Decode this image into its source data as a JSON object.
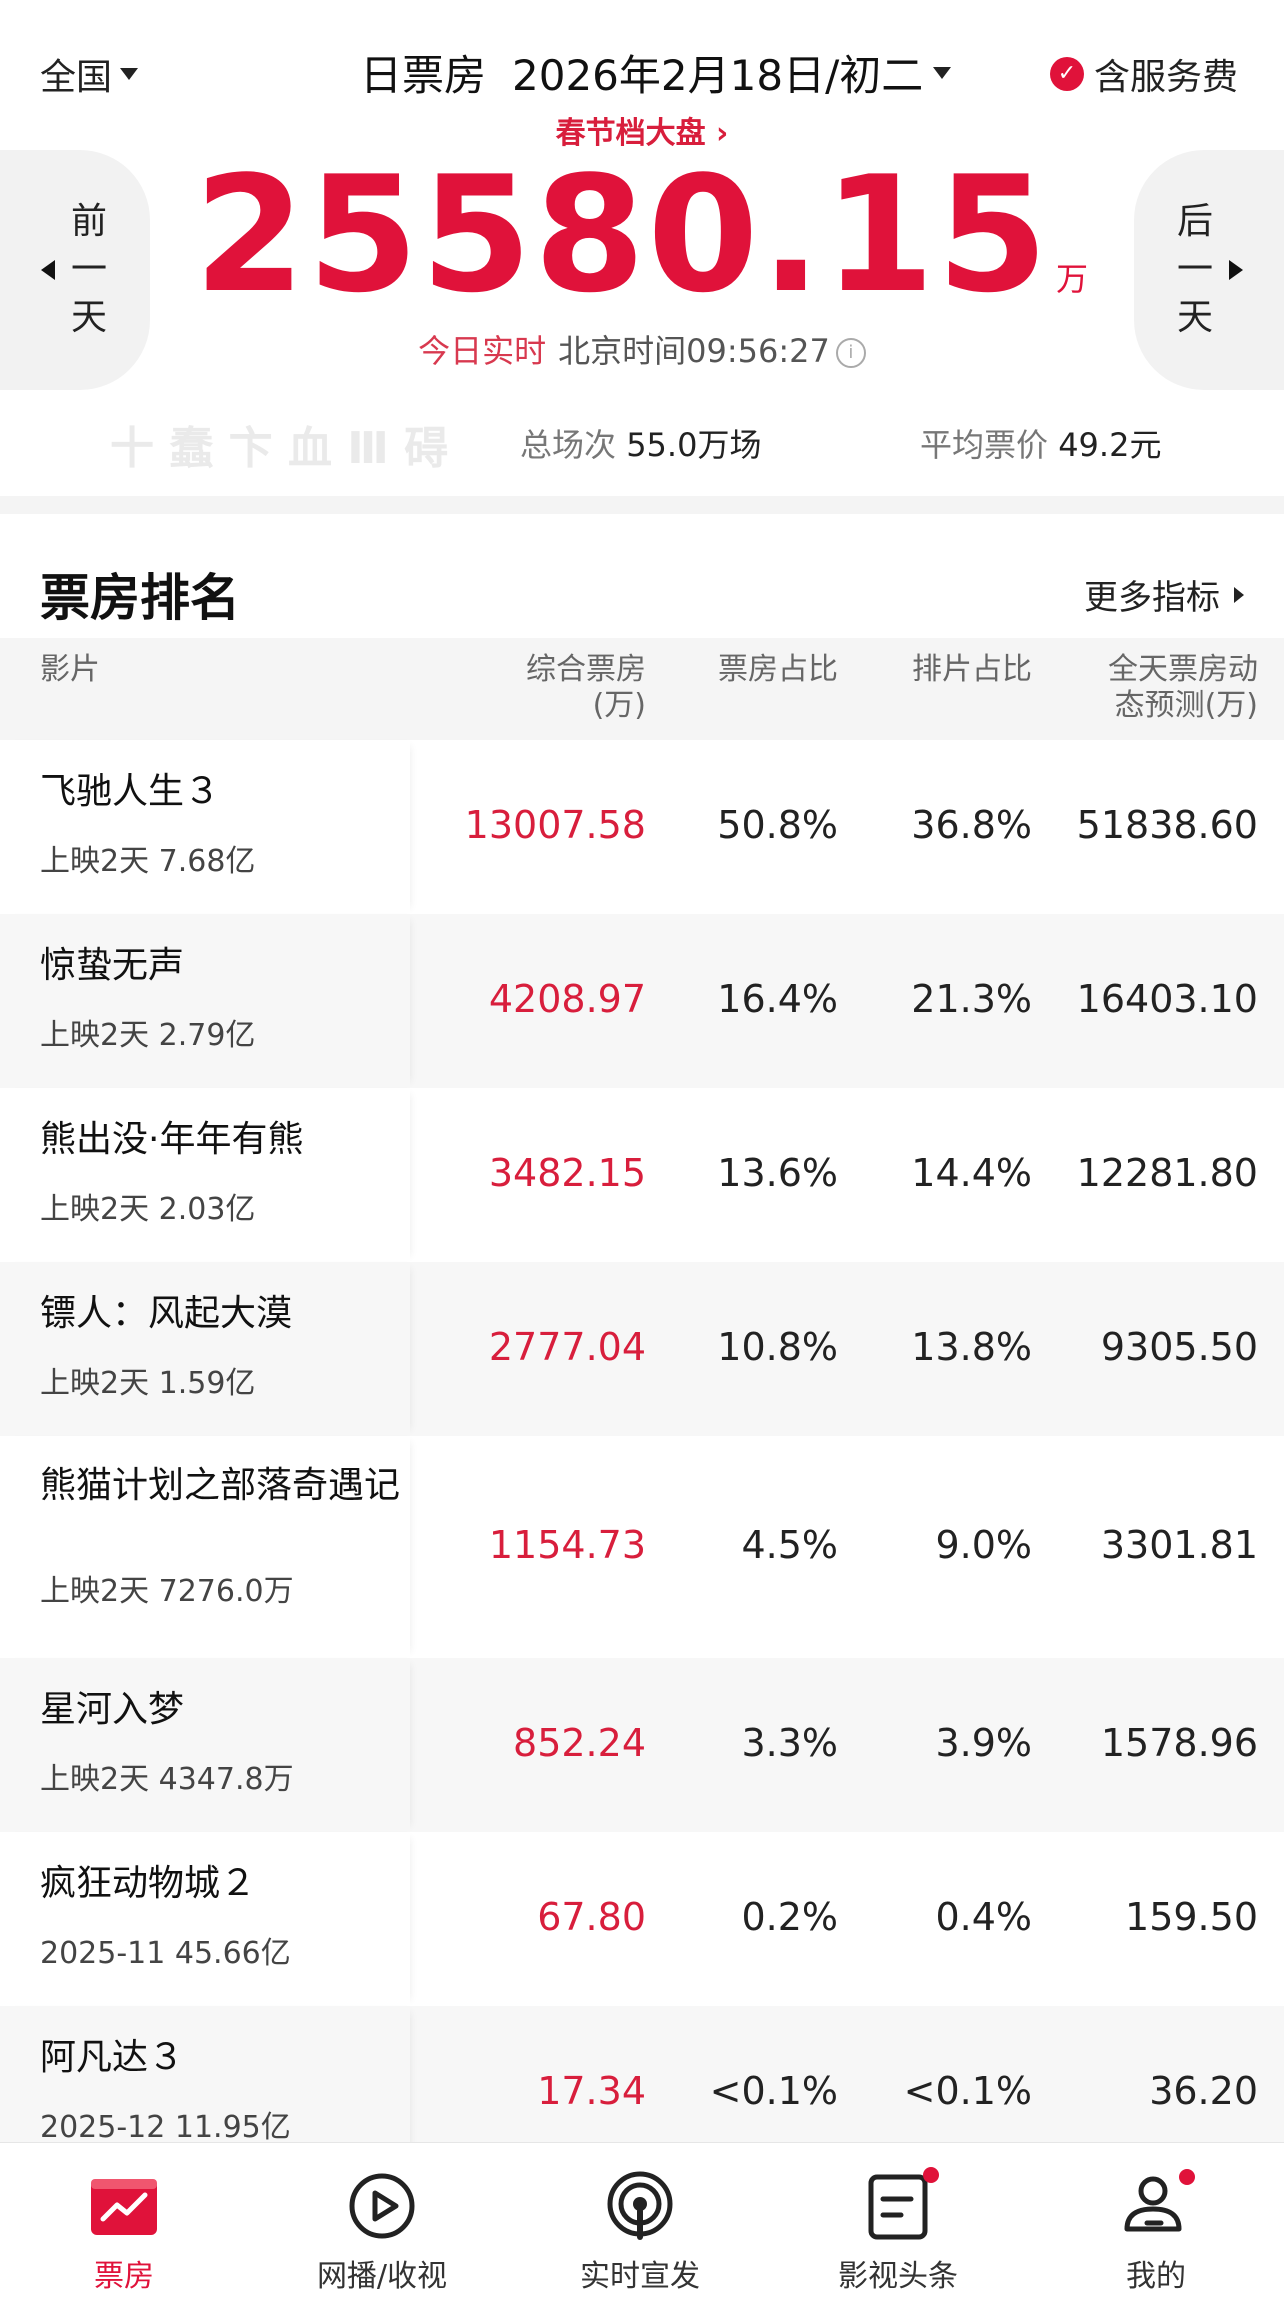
{
  "header": {
    "region": "全国",
    "title": "日票房",
    "date": "2026年2月18日/初二",
    "service_fee": "含服务费",
    "season_link": "春节档大盘 ›",
    "total_box_office": "25580.15",
    "unit": "万",
    "realtime_label": "今日实时",
    "beijing_time": "北京时间09:56:27",
    "prev_day": "前一天",
    "next_day": "后一天"
  },
  "stats": {
    "ghost_text": "十 蠢 卞 血 Ⅲ 碍",
    "screenings_label": "总场次",
    "screenings_value": "55.0万场",
    "avg_price_label": "平均票价",
    "avg_price_value": "49.2元"
  },
  "ranking": {
    "title": "票房排名",
    "more_label": "更多指标",
    "columns": {
      "film": "影片",
      "box": "综合票房",
      "box_unit": "(万)",
      "box_share": "票房占比",
      "screen_share": "排片占比",
      "forecast_line1": "全天票房动",
      "forecast_line2": "态预测(万)"
    },
    "rows": [
      {
        "name": "飞驰人生３",
        "meta": "上映2天 7.68亿",
        "box": "13007.58",
        "box_share": "50.8%",
        "screen_share": "36.8%",
        "forecast": "51838.60"
      },
      {
        "name": "惊蛰无声",
        "meta": "上映2天 2.79亿",
        "box": "4208.97",
        "box_share": "16.4%",
        "screen_share": "21.3%",
        "forecast": "16403.10"
      },
      {
        "name": "熊出没·年年有熊",
        "meta": "上映2天 2.03亿",
        "box": "3482.15",
        "box_share": "13.6%",
        "screen_share": "14.4%",
        "forecast": "12281.80"
      },
      {
        "name": "镖人：风起大漠",
        "meta": "上映2天 1.59亿",
        "box": "2777.04",
        "box_share": "10.8%",
        "screen_share": "13.8%",
        "forecast": "9305.50"
      },
      {
        "name": "熊猫计划之部落奇遇记",
        "meta": "上映2天 7276.0万",
        "box": "1154.73",
        "box_share": "4.5%",
        "screen_share": "9.0%",
        "forecast": "3301.81"
      },
      {
        "name": "星河入梦",
        "meta": "上映2天 4347.8万",
        "box": "852.24",
        "box_share": "3.3%",
        "screen_share": "3.9%",
        "forecast": "1578.96"
      },
      {
        "name": "疯狂动物城２",
        "meta": "2025-11 45.66亿",
        "box": "67.80",
        "box_share": "0.2%",
        "screen_share": "0.4%",
        "forecast": "159.50"
      },
      {
        "name": "阿凡达３",
        "meta": "2025-12 11.95亿",
        "box": "17.34",
        "box_share": "<0.1%",
        "screen_share": "<0.1%",
        "forecast": "36.20"
      }
    ]
  },
  "nav": {
    "items": [
      {
        "label": "票房",
        "icon": "box-office-chart-icon",
        "active": true
      },
      {
        "label": "网播/收视",
        "icon": "play-icon"
      },
      {
        "label": "实时宣发",
        "icon": "broadcast-icon",
        "badge": true
      },
      {
        "label": "影视头条",
        "icon": "news-icon",
        "badge": true
      },
      {
        "label": "我的",
        "icon": "profile-icon",
        "badge": true
      }
    ]
  },
  "colors": {
    "accent": "#e0123a",
    "text": "#1a1a1a",
    "muted": "#777777",
    "row_alt": "#f7f7f7"
  }
}
